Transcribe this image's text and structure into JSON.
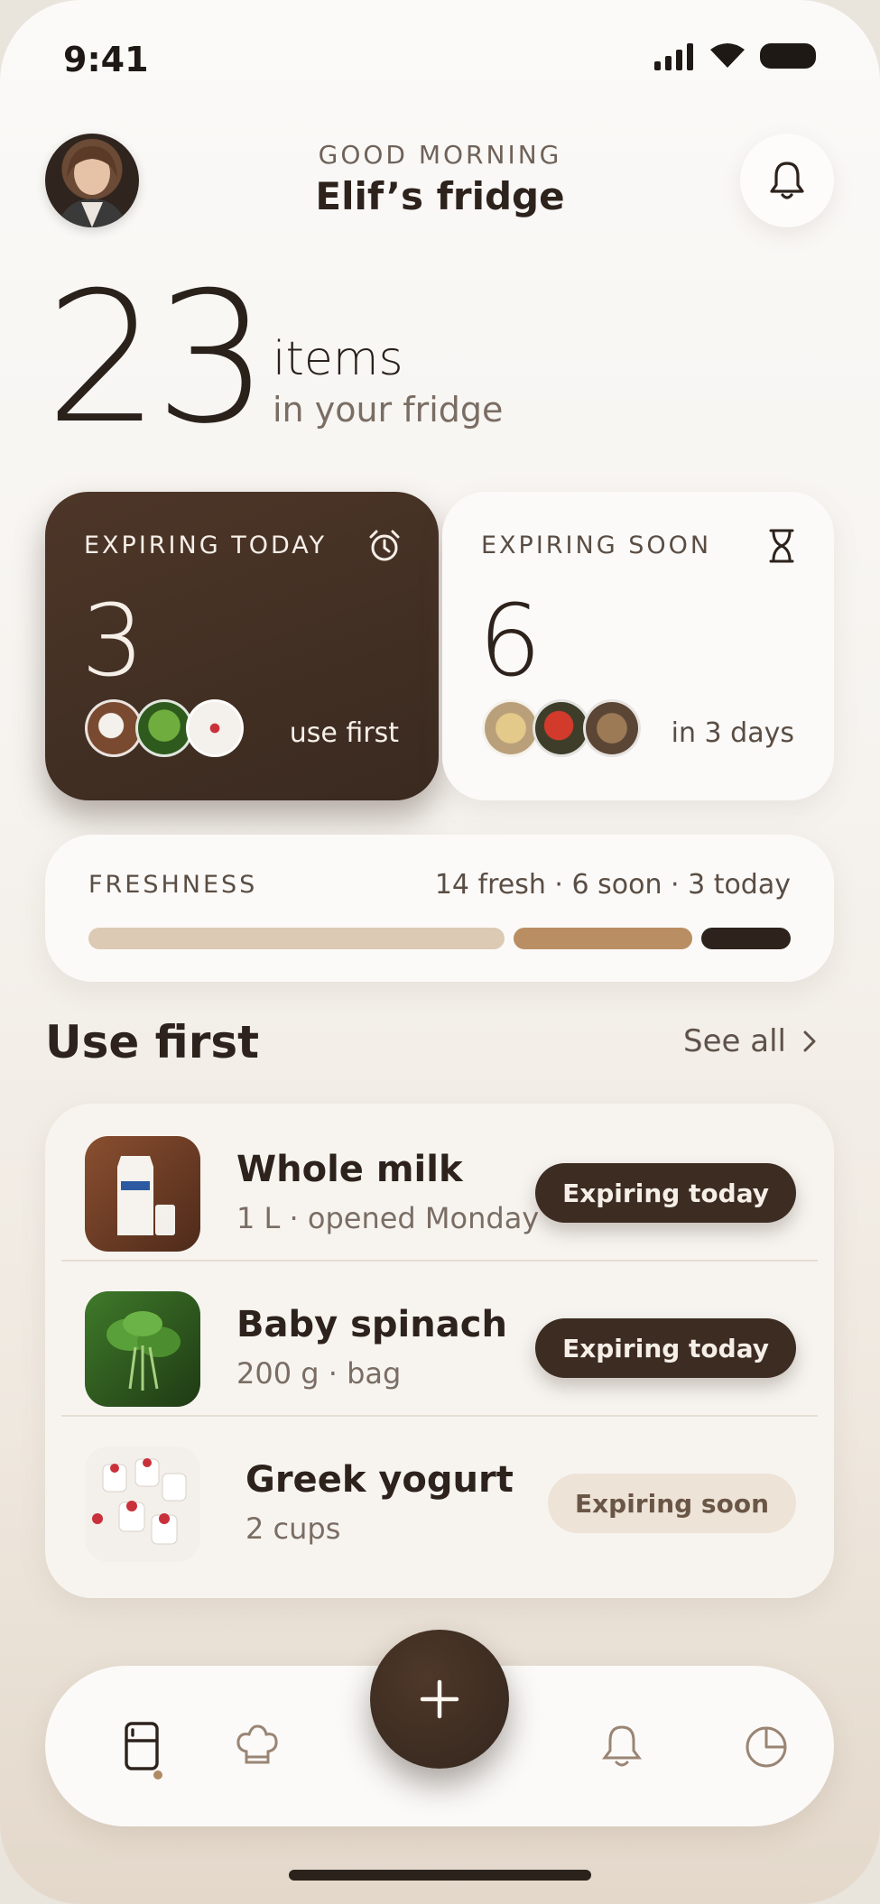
{
  "status_bar": {
    "time": "9:41"
  },
  "header": {
    "greeting": "GOOD MORNING",
    "title": "Elif’s fridge"
  },
  "summary": {
    "count": "23",
    "label": "items",
    "sublabel": "in your fridge"
  },
  "cards": {
    "today": {
      "label": "EXPIRING TODAY",
      "count": "3",
      "foot": "use first",
      "icon": "alarm-clock-icon"
    },
    "soon": {
      "label": "EXPIRING SOON",
      "count": "6",
      "foot": "in 3 days",
      "icon": "hourglass-icon"
    }
  },
  "freshness": {
    "label": "FRESHNESS",
    "counts": "14 fresh · 6 soon · 3 today",
    "fresh": 14,
    "soon": 6,
    "today": 3,
    "colors": {
      "fresh": "#dccab5",
      "soon": "#ba8e63",
      "today": "#2d221c"
    }
  },
  "use_first": {
    "title": "Use first",
    "see_all": "See all",
    "items": [
      {
        "name": "Whole milk",
        "detail": "1 L · opened Monday",
        "status": "Expiring today",
        "status_style": "dark"
      },
      {
        "name": "Baby spinach",
        "detail": "200 g · bag",
        "status": "Expiring today",
        "status_style": "dark"
      },
      {
        "name": "Greek yogurt",
        "detail": "2 cups",
        "status": "Expiring soon",
        "status_style": "light"
      }
    ]
  },
  "nav": {
    "items": [
      "fridge-icon",
      "chef-hat-icon",
      "bell-icon",
      "pie-chart-icon"
    ],
    "active": "fridge-icon",
    "fab": "plus-icon"
  },
  "colors": {
    "accent_dark": "#3d2c22",
    "background": "#f6f3ef",
    "muted": "#7a6d64"
  }
}
